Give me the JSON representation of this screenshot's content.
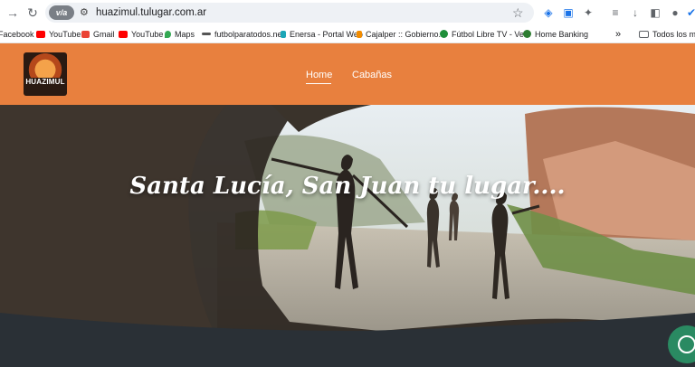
{
  "browser": {
    "url": "huazimul.tulugar.com.ar",
    "site_badge": "v/a",
    "bookmarks": [
      {
        "label": "Facebook",
        "icon": "facebook-icon",
        "color": "#1877f2"
      },
      {
        "label": "YouTube",
        "icon": "youtube-icon",
        "color": "#ff0000"
      },
      {
        "label": "Gmail",
        "icon": "gmail-icon",
        "color": "#ea4335"
      },
      {
        "label": "YouTube",
        "icon": "youtube-icon",
        "color": "#ff0000"
      },
      {
        "label": "Maps",
        "icon": "maps-icon",
        "color": "#34a853"
      },
      {
        "label": "futbolparatodos.net",
        "icon": "link-icon",
        "color": "#555555"
      },
      {
        "label": "Enersa - Portal Web",
        "icon": "enersa-icon",
        "color": "#1aa6b7"
      },
      {
        "label": "Cajalper :: Gobierno...",
        "icon": "cajalper-icon",
        "color": "#f28c00"
      },
      {
        "label": "Fútbol Libre TV - Ve...",
        "icon": "futbol-libre-icon",
        "color": "#1f8f3a"
      },
      {
        "label": "Home Banking",
        "icon": "home-banking-icon",
        "color": "#2e7d32"
      }
    ],
    "more_bookmarks": "»",
    "all_bookmarks_label": "Todos los marc"
  },
  "site": {
    "logo_text": "HUAZIMUL",
    "nav": [
      {
        "label": "Home",
        "active": true
      },
      {
        "label": "Cabañas",
        "active": false
      }
    ],
    "hero_title": "Santa Lucía, San Juan tu lugar...."
  },
  "colors": {
    "header_bg": "#e8803e",
    "whatsapp": "#2a8a62"
  }
}
